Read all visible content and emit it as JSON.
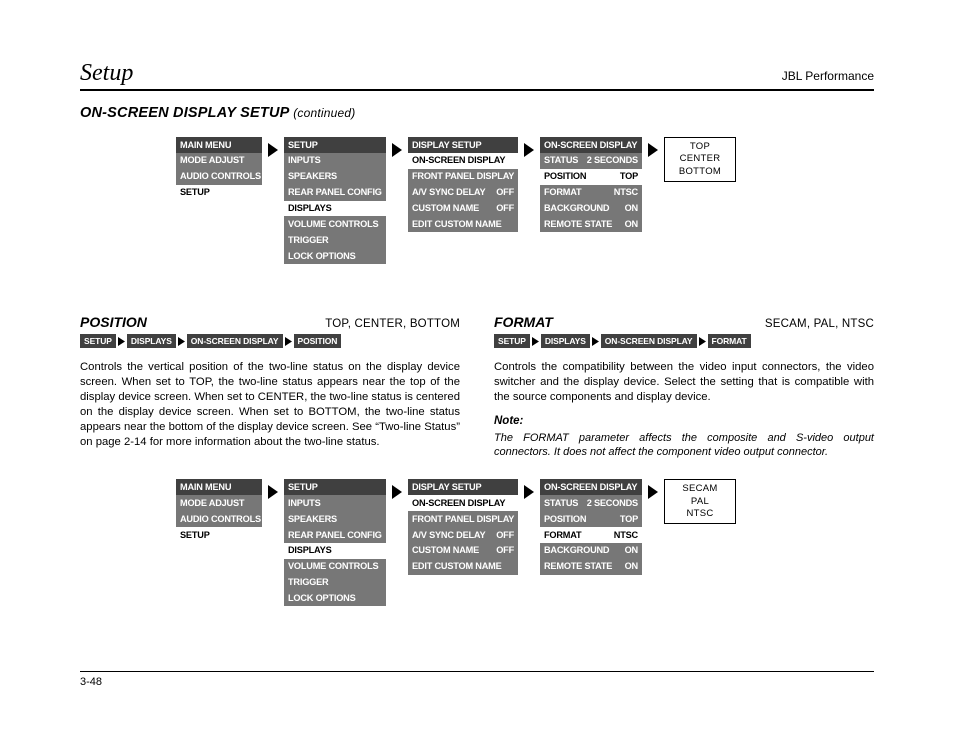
{
  "header": {
    "left": "Setup",
    "right": "JBL Performance"
  },
  "section_title": {
    "main": "ON-SCREEN DISPLAY SETUP",
    "cont": "(continued)"
  },
  "nav1": {
    "m1": {
      "hd": "MAIN MENU",
      "r0": "MODE ADJUST",
      "r1": "AUDIO CONTROLS",
      "r2": "SETUP"
    },
    "m2": {
      "hd": "SETUP",
      "r0": "INPUTS",
      "r1": "SPEAKERS",
      "r2": "REAR PANEL CONFIG",
      "r3": "DISPLAYS",
      "r4": "VOLUME CONTROLS",
      "r5": "TRIGGER",
      "r6": "LOCK OPTIONS"
    },
    "m3": {
      "hd": "DISPLAY SETUP",
      "r0": "ON-SCREEN DISPLAY",
      "r1": "FRONT PANEL DISPLAY",
      "r2": "A/V SYNC DELAY",
      "v2": "OFF",
      "r3": "CUSTOM NAME",
      "v3": "OFF",
      "r4": "EDIT CUSTOM NAME"
    },
    "m4": {
      "hd": "ON-SCREEN DISPLAY",
      "r0": "STATUS",
      "v0": "2 SECONDS",
      "r1": "POSITION",
      "v1": "TOP",
      "r2": "FORMAT",
      "v2": "NTSC",
      "r3": "BACKGROUND",
      "v3": "ON",
      "r4": "REMOTE STATE",
      "v4": "ON"
    },
    "opt": {
      "o0": "TOP",
      "o1": "CENTER",
      "o2": "BOTTOM"
    }
  },
  "nav2": {
    "opt": {
      "o0": "SECAM",
      "o1": "PAL",
      "o2": "NTSC"
    }
  },
  "position": {
    "name": "POSITION",
    "range": "TOP, CENTER, BOTTOM",
    "bc": {
      "b0": "SETUP",
      "b1": "DISPLAYS",
      "b2": "ON-SCREEN DISPLAY",
      "b3": "POSITION"
    },
    "text": "Controls the vertical position of the two-line status on the display device screen. When set to TOP, the two-line status appears near the top of the display device screen. When set to CENTER, the two-line status is centered on the display device screen. When set to BOTTOM, the two-line status appears near the bottom of the display device screen. See “Two-line Status” on page 2-14 for more information about the two-line status."
  },
  "format": {
    "name": "FORMAT",
    "range": "SECAM, PAL, NTSC",
    "bc": {
      "b0": "SETUP",
      "b1": "DISPLAYS",
      "b2": "ON-SCREEN DISPLAY",
      "b3": "FORMAT"
    },
    "text": "Controls the compatibility between the video input connectors, the video switcher and the display device. Select the setting that is compatible with the source components and display device.",
    "note_label": "Note:",
    "note_text": "The FORMAT parameter affects the composite and S-video output connectors. It does not affect the component video output connector."
  },
  "footer": {
    "page": "3-48"
  }
}
